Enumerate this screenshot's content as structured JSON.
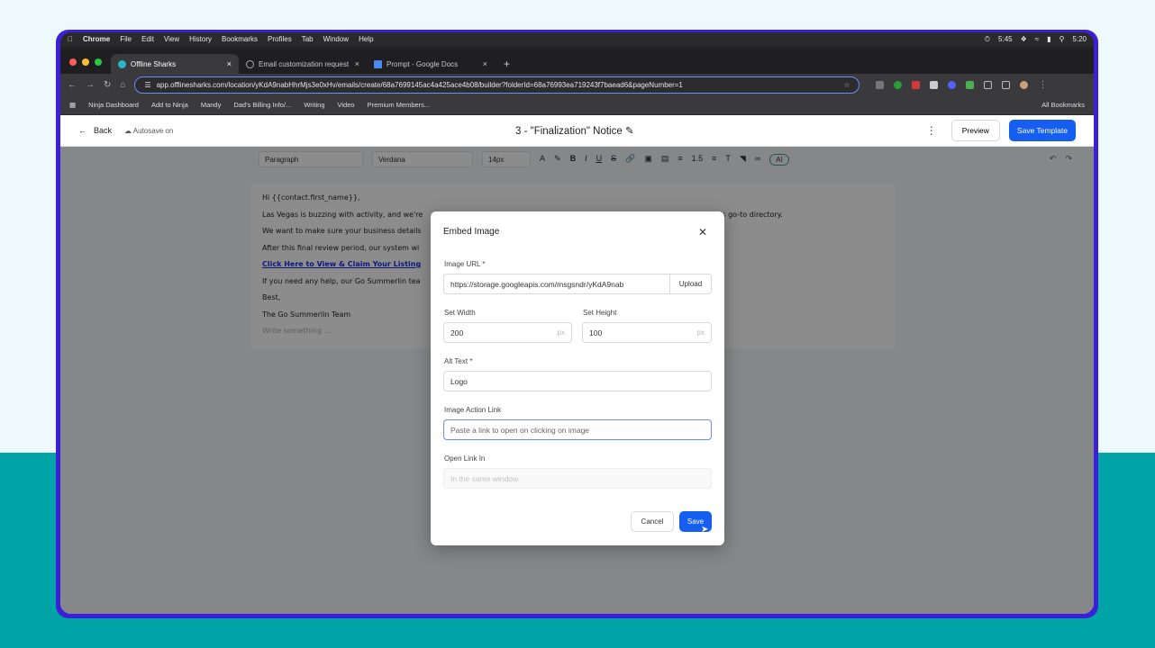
{
  "colors": {
    "accent": "#155eef",
    "teal": "#00a3a6",
    "frame": "#3d1fd9"
  },
  "menubar": {
    "app": "Chrome",
    "items": [
      "File",
      "Edit",
      "View",
      "History",
      "Bookmarks",
      "Profiles",
      "Tab",
      "Window",
      "Help"
    ],
    "timer": "5:45",
    "clock": "5:20"
  },
  "tabs": [
    {
      "title": "Offline Sharks",
      "active": true
    },
    {
      "title": "Email customization request",
      "active": false
    },
    {
      "title": "Prompt - Google Docs",
      "active": false
    }
  ],
  "browser": {
    "url": "app.offlinesharks.com/location/yKdA9nabHhrMjs3e0xHv/emails/create/68a7699145ac4a425ace4b08/builder?folderId=68a76993ea719243f7baead6&pageNumber=1"
  },
  "bookmarks": [
    "Ninja Dashboard",
    "Add to Ninja",
    "Mandy",
    "Dad's Billing Info/...",
    "Writing",
    "Video",
    "Premium Members..."
  ],
  "bookmarks_all": "All Bookmarks",
  "header": {
    "back": "Back",
    "autosave": "Autosave on",
    "title": "3 - \"Finalization\" Notice",
    "preview": "Preview",
    "save_template": "Save Template"
  },
  "format": {
    "block": "Paragraph",
    "font": "Verdana",
    "size": "14px",
    "line_height": "1.5",
    "ai": "AI"
  },
  "email": {
    "lines": [
      "Hi {{contact.first_name}},",
      "Las Vegas is buzzing with activity, and we're",
      "We want to make sure your business details",
      "After this final review period, our system wi",
      "Click Here to View & Claim Your Listing",
      "If you need any help, our Go Summerlin tea",
      "Best,",
      "The Go Summerlin Team"
    ],
    "line2_tail": "nity's go-to directory.",
    "placeholder": "Write something ..."
  },
  "modal": {
    "title": "Embed Image",
    "image_url_label": "Image URL",
    "required_mark": "*",
    "image_url_value": "https://storage.googleapis.com/msgsndr/yKdA9nab",
    "upload": "Upload",
    "width_label": "Set Width",
    "width_value": "200",
    "height_label": "Set Height",
    "height_value": "100",
    "unit": "px",
    "alt_label": "Alt Text",
    "alt_value": "Logo",
    "link_label": "Image Action Link",
    "link_placeholder": "Paste a link to open on clicking on image",
    "open_label": "Open Link In",
    "open_value": "In the same window",
    "cancel": "Cancel",
    "save": "Save"
  }
}
